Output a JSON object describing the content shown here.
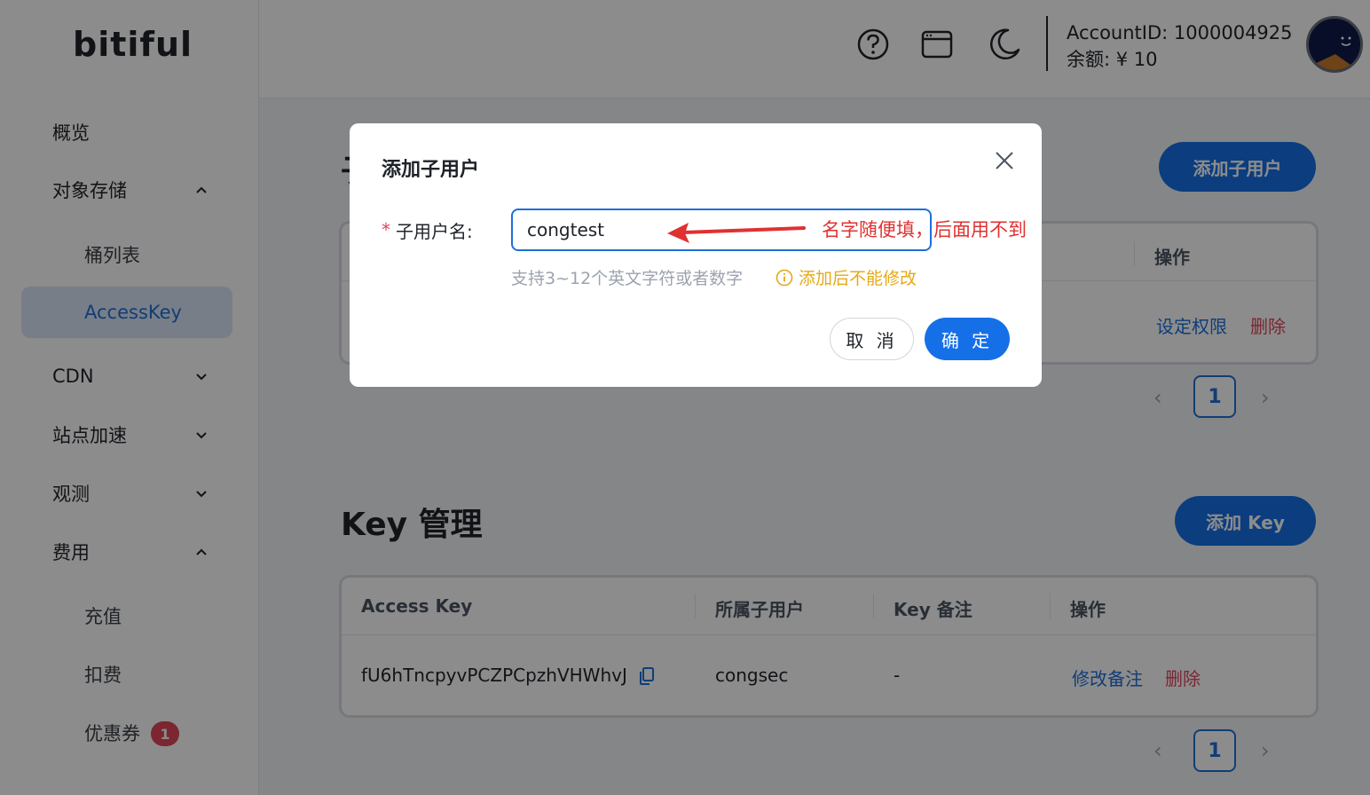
{
  "app": {
    "logo": "bitiful"
  },
  "sidebar": {
    "items": [
      {
        "label": "概览"
      },
      {
        "label": "对象存储"
      },
      {
        "label": "桶列表"
      },
      {
        "label": "AccessKey"
      },
      {
        "label": "CDN"
      },
      {
        "label": "站点加速"
      },
      {
        "label": "观测"
      },
      {
        "label": "费用"
      },
      {
        "label": "充值"
      },
      {
        "label": "扣费"
      },
      {
        "label": "优惠券",
        "badge": "1"
      }
    ]
  },
  "header": {
    "account_id": "AccountID: 1000004925",
    "balance": "余额: ¥ 10",
    "icons": [
      "help-icon",
      "window-icon",
      "moon-icon"
    ]
  },
  "subusers": {
    "title_fragment": "子",
    "add_button": "添加子用户",
    "headers": {
      "ops": "操作"
    },
    "row": {
      "action1": "设定权限",
      "action2": "删除"
    },
    "page": "1"
  },
  "keys": {
    "title": "Key 管理",
    "add_button": "添加 Key",
    "headers": {
      "access_key": "Access Key",
      "subuser": "所属子用户",
      "remark": "Key 备注",
      "ops": "操作"
    },
    "row": {
      "access_key": "fU6hTncpyvPCZPCpzhVHWhvJ",
      "subuser": "congsec",
      "remark": "-",
      "action1": "修改备注",
      "action2": "删除"
    },
    "page": "1"
  },
  "modal": {
    "title": "添加子用户",
    "field_label": "子用户名:",
    "required_mark": "*",
    "input_value": "congtest",
    "hint": "支持3~12个英文字符或者数字",
    "warning": "添加后不能修改",
    "annotation": "名字随便填，后面用不到",
    "cancel": "取 消",
    "confirm": "确 定"
  },
  "colors": {
    "accent": "#1570e8",
    "danger": "#e0455a",
    "warning": "#e6a817",
    "annotation": "#e03131"
  }
}
